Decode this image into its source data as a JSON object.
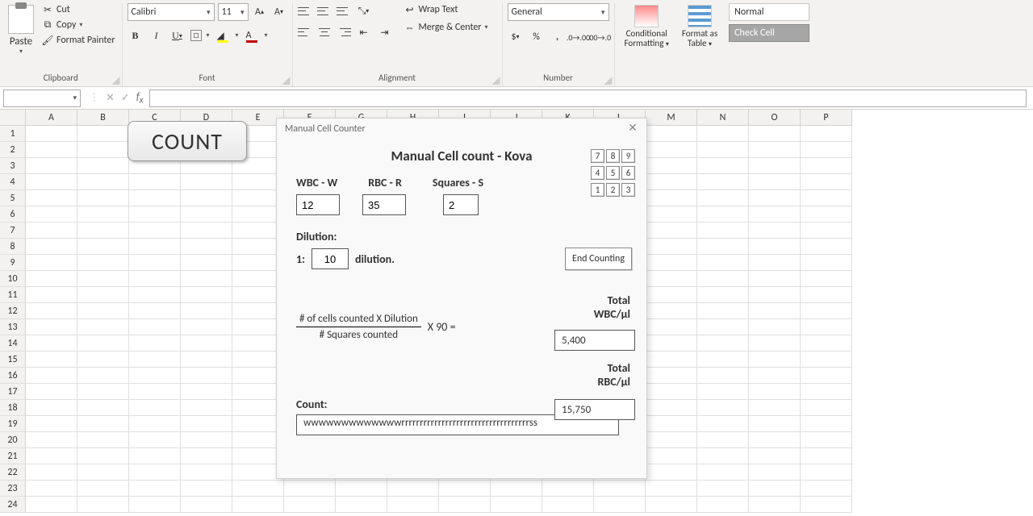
{
  "ribbon": {
    "clipboard": {
      "paste": "Paste",
      "cut": "Cut",
      "copy": "Copy",
      "format_painter": "Format Painter",
      "group": "Clipboard"
    },
    "font": {
      "name": "Calibri",
      "size": "11",
      "group": "Font"
    },
    "alignment": {
      "wrap": "Wrap Text",
      "merge": "Merge & Center",
      "group": "Alignment"
    },
    "number": {
      "format": "General",
      "group": "Number"
    },
    "styles": {
      "cond": "Conditional Formatting",
      "cond1": "Conditional",
      "cond2": "Formatting",
      "fmt": "Format as Table",
      "fmt1": "Format as",
      "fmt2": "Table",
      "normal": "Normal",
      "check": "Check Cell"
    }
  },
  "columns": [
    "A",
    "B",
    "C",
    "D",
    "E",
    "F",
    "G",
    "H",
    "I",
    "J",
    "K",
    "L",
    "M",
    "N",
    "O",
    "P"
  ],
  "count_button": "COUNT",
  "dialog": {
    "title": "Manual Cell Counter",
    "heading": "Manual Cell count - Kova",
    "labels": {
      "wbc": "WBC - W",
      "rbc": "RBC - R",
      "sq": "Squares - S",
      "dilution_h": "Dilution:",
      "one_to": "1:",
      "dilution_w": "dilution.",
      "end": "End Counting",
      "count": "Count:"
    },
    "values": {
      "wbc": "12",
      "rbc": "35",
      "sq": "2",
      "dilution": "10"
    },
    "numpad": [
      "7",
      "8",
      "9",
      "4",
      "5",
      "6",
      "1",
      "2",
      "3"
    ],
    "formula": {
      "top": "# of cells counted  X  Dilution",
      "bot": "# Squares counted",
      "tail": "X 90   ="
    },
    "totals": {
      "wbc_label1": "Total",
      "wbc_label2": "WBC/µl",
      "wbc_val": "5,400",
      "rbc_label1": "Total",
      "rbc_label2": "RBC/µl",
      "rbc_val": "15,750"
    },
    "count_text": "wwwwwwwwwwwwwrrrrrrrrrrrrrrrrrrrrrrrrrrrrrrrrrrrss"
  },
  "chart_data": {
    "type": "table",
    "title": "Manual Cell count - Kova",
    "inputs": {
      "WBC": 12,
      "RBC": 35,
      "Squares": 2,
      "Dilution": 10
    },
    "formula": "(# of cells counted × Dilution / # Squares counted) × 90",
    "results": {
      "Total WBC/µl": 5400,
      "Total RBC/µl": 15750
    }
  }
}
